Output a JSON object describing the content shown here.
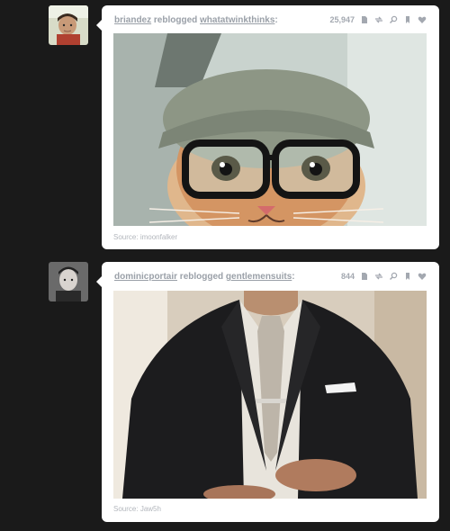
{
  "posts": [
    {
      "user": "briandez",
      "action": "reblogged",
      "from": "whatatwinkthinks",
      "punct": ":",
      "notes": "25,947",
      "source_label": "Source:",
      "source_name": "imoonfalker",
      "photo_subject": "kitten wearing knit beanie and black glasses"
    },
    {
      "user": "dominicportair",
      "action": "reblogged",
      "from": "gentlemensuits",
      "punct": ":",
      "notes": "844",
      "source_label": "Source:",
      "source_name": "Jaw5h",
      "photo_subject": "man in dark suit and silver tie"
    }
  ],
  "colors": {
    "background": "#1a1a1a",
    "card": "#ffffff",
    "meta_text": "#9aa0a8"
  }
}
